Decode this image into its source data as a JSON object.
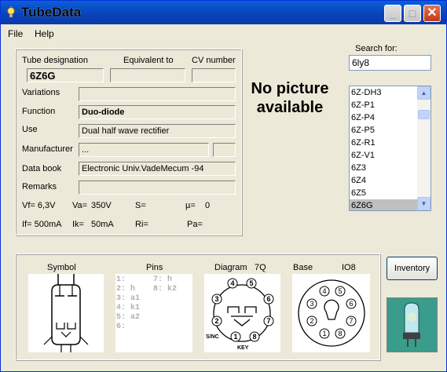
{
  "window": {
    "title": "TubeData"
  },
  "menu": {
    "file": "File",
    "help": "Help"
  },
  "fields": {
    "tube_designation_label": "Tube designation",
    "tube_designation": "6Z6G",
    "equivalent_label": "Equivalent to",
    "equivalent": "",
    "cv_label": "CV number",
    "cv": "",
    "variations_label": "Variations",
    "variations": "",
    "function_label": "Function",
    "function": "Duo-diode",
    "use_label": "Use",
    "use": "Dual half wave rectifier",
    "manufacturer_label": "Manufacturer",
    "manufacturer": "...",
    "manufacturer_extra": "",
    "databook_label": "Data book",
    "databook": "Electronic Univ.VadeMecum -94",
    "remarks_label": "Remarks",
    "remarks": ""
  },
  "params": {
    "vf": "Vf= 6,3V",
    "va": "Va=",
    "va_val": "350V",
    "s": "S=",
    "mu": "µ=",
    "mu_val": "0",
    "if": "If= 500mA",
    "ik": "Ik=",
    "ik_val": "50mA",
    "ri": "Ri=",
    "pa": "Pa="
  },
  "picture": {
    "no_picture": "No picture available"
  },
  "search": {
    "label": "Search for:",
    "value": "6ly8"
  },
  "tube_list": {
    "items": [
      "6Z-DH3",
      "6Z-P1",
      "6Z-P4",
      "6Z-P5",
      "6Z-R1",
      "6Z-V1",
      "6Z3",
      "6Z4",
      "6Z5",
      "6Z6G"
    ],
    "selected": "6Z6G"
  },
  "bottom": {
    "symbol_label": "Symbol",
    "pins_label": "Pins",
    "diagram_label": "Diagram",
    "diagram_code": "7Q",
    "base_label": "Base",
    "base_code": "IO8",
    "pins": [
      "1:",
      "2: h",
      "3: a1",
      "4: k1",
      "5: a2",
      "6:"
    ],
    "pins_right": [
      "7: h",
      "8: k2"
    ],
    "diagram_notes": {
      "snc": "S/NC",
      "key": "KEY"
    },
    "diagram_pin_numbers": [
      "1",
      "2",
      "3",
      "4",
      "5",
      "6",
      "7",
      "8"
    ]
  },
  "buttons": {
    "inventory": "Inventory"
  },
  "colors": {
    "titlebar": "#0842b8",
    "face": "#ece9d8",
    "selection": "#c0c0c0"
  }
}
